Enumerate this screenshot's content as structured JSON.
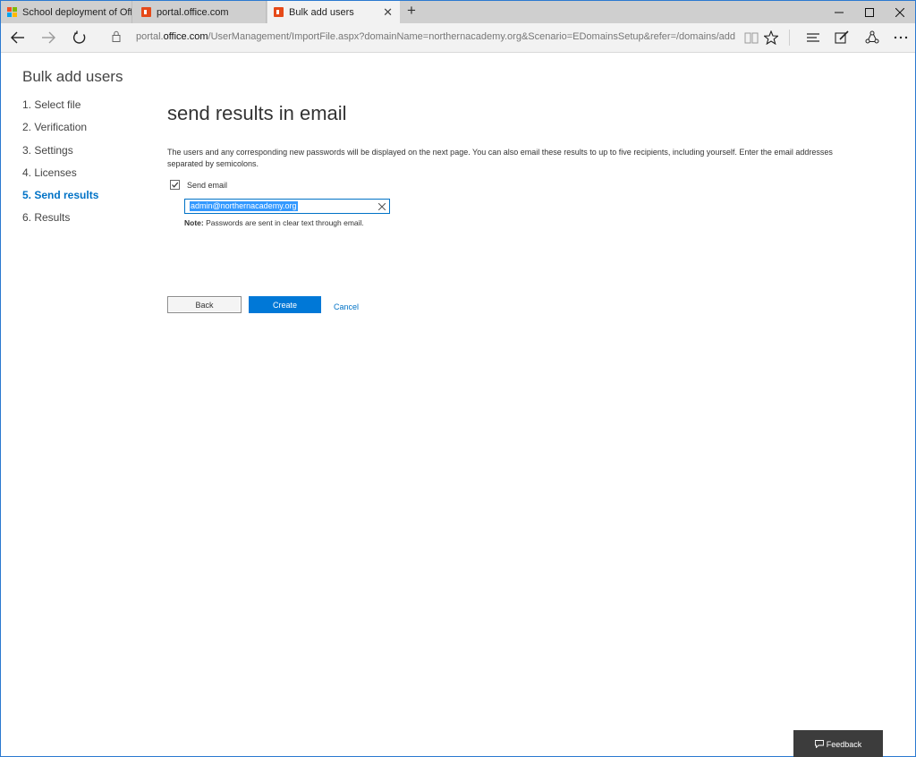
{
  "browser": {
    "tabs": [
      {
        "label": "School deployment of Offic",
        "favicon": "microsoft-logo"
      },
      {
        "label": "portal.office.com",
        "favicon": "office-logo"
      },
      {
        "label": "Bulk add users",
        "favicon": "office-logo",
        "active": true
      }
    ],
    "new_tab_glyph": "+",
    "close_glyph": "✕",
    "url_prefix": "portal.",
    "url_domain": "office.com",
    "url_path": "/UserManagement/ImportFile.aspx?domainName=northernacademy.org&Scenario=EDomainsSetup&refer=/domains/add",
    "colors": {
      "tabbar": "#cfcfcf",
      "active_tab": "#f2f2f2",
      "accent": "#0072c6"
    }
  },
  "wizard": {
    "title": "Bulk add users",
    "steps": [
      {
        "label": "1.  Select file"
      },
      {
        "label": "2.  Verification"
      },
      {
        "label": "3.  Settings"
      },
      {
        "label": "4.  Licenses"
      },
      {
        "label": "5.  Send results",
        "current": true
      },
      {
        "label": "6.  Results"
      }
    ]
  },
  "main": {
    "section_title": "send results in email",
    "description": "The users and any corresponding new passwords will be displayed on the next page. You can also email these results to up to five recipients, including yourself. Enter the email addresses separated by semicolons.",
    "send_email": {
      "label": "Send email",
      "checked": true
    },
    "email_value": "admin@northernacademy.org",
    "note_label": "Note:",
    "note_text": " Passwords are sent in clear text through email."
  },
  "actions": {
    "back": "Back",
    "create": "Create",
    "cancel": "Cancel"
  },
  "feedback": {
    "label": "Feedback"
  }
}
